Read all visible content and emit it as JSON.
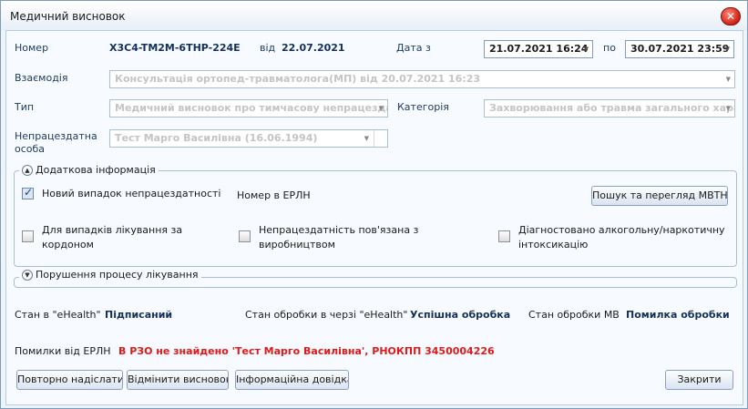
{
  "window": {
    "title": "Медичний висновок",
    "close_label": "✕"
  },
  "header": {
    "number_label": "Номер",
    "number_value": "X3C4-TM2M-6THP-224E",
    "from_label": "від",
    "from_value": "22.07.2021",
    "date_from_label": "Дата з",
    "date_from_value": "21.07.2021 16:24",
    "date_to_label": "по",
    "date_to_value": "30.07.2021 23:59"
  },
  "fields": {
    "interaction_label": "Взаємодія",
    "interaction_value": "Консультація ортопед-травматолога(МП) від 20.07.2021 16:23",
    "type_label": "Тип",
    "type_value": "Медичний висновок про тимчасову непрацездатність",
    "category_label": "Категорія",
    "category_value": "Захворювання або травма загального характеру",
    "person_label_line1": "Непрацездатна",
    "person_label_line2": "особа",
    "person_value": "Тест Марго Василівна (16.06.1994)"
  },
  "additional": {
    "header": "Додаткова інформація",
    "new_case_label": "Новий випадок непрацездатності",
    "new_case_checked": true,
    "erln_number_label": "Номер в ЕРЛН",
    "search_button": "Пошук та перегляд МВТН",
    "abroad_line1": "Для випадків лікування за",
    "abroad_line2": "кордоном",
    "work_line1": "Непрацездатність пов'язана з",
    "work_line2": "виробництвом",
    "alcohol_line1": "Діагностовано алкогольну/наркотичну",
    "alcohol_line2": "інтоксикацію"
  },
  "violation": {
    "header": "Порушення процесу лікування"
  },
  "status": {
    "ehealth_label": "Стан в \"eHealth\"",
    "ehealth_value": "Підписаний",
    "queue_label": "Стан обробки в черзі \"eHealth\"",
    "queue_value": "Успішна обробка",
    "mv_label": "Стан обробки МВ",
    "mv_value": "Помилка обробки"
  },
  "errors": {
    "label": "Помилки від ЕРЛН",
    "message": "В РЗО не знайдено 'Тест Марго Василівна', РНОКПП 3450004226"
  },
  "buttons": {
    "resend": "Повторно надіслати",
    "cancel": "Відмінити висновок",
    "info": "Інформаційна довідка",
    "close": "Закрити"
  },
  "colors": {
    "error": "#e01818",
    "value_text": "#14305a",
    "disabled_text": "#c4c4c4"
  },
  "icons": {
    "close": "close-icon",
    "dropdown": "chevron-down-icon",
    "expand": "chevron-up-icon",
    "collapse": "chevron-down-icon"
  }
}
